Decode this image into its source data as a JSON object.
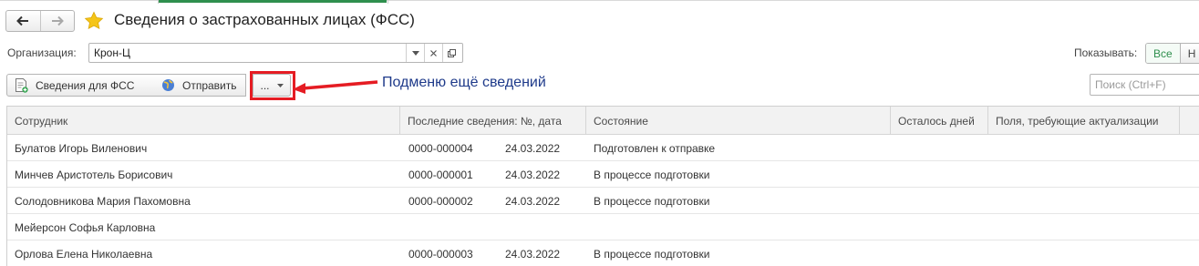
{
  "header": {
    "title": "Сведения о застрахованных лицах (ФСС)"
  },
  "filters": {
    "org_label": "Организация:",
    "org_value": "Крон-Ц",
    "show_label": "Показывать:",
    "show_options": [
      "Все",
      "Н"
    ]
  },
  "toolbar": {
    "svedeniya_label": "Сведения для ФСС",
    "otpravit_label": "Отправить",
    "more_label": "..."
  },
  "annotation": {
    "text": "Подменю ещё сведений",
    "color": "#e51c23"
  },
  "search": {
    "placeholder": "Поиск (Ctrl+F)"
  },
  "table": {
    "columns": [
      "Сотрудник",
      "Последние сведения: №, дата",
      "Состояние",
      "Осталось дней",
      "Поля, требующие актуализации"
    ],
    "rows": [
      {
        "employee": "Булатов Игорь Виленович",
        "number": "0000-000004",
        "date": "24.03.2022",
        "status": "Подготовлен к отправке"
      },
      {
        "employee": "Минчев Аристотель Борисович",
        "number": "0000-000001",
        "date": "24.03.2022",
        "status": "В процессе подготовки"
      },
      {
        "employee": "Солодовникова Мария Пахомовна",
        "number": "0000-000002",
        "date": "24.03.2022",
        "status": "В процессе подготовки"
      },
      {
        "employee": "Мейерсон Софья Карловна",
        "number": "",
        "date": "",
        "status": ""
      },
      {
        "employee": "Орлова Елена Николаевна",
        "number": "0000-000003",
        "date": "24.03.2022",
        "status": "В процессе подготовки"
      }
    ]
  },
  "colors": {
    "accent_green": "#2f8f4e",
    "star_yellow": "#f5c518",
    "annotation_text": "#1e3a8a"
  }
}
